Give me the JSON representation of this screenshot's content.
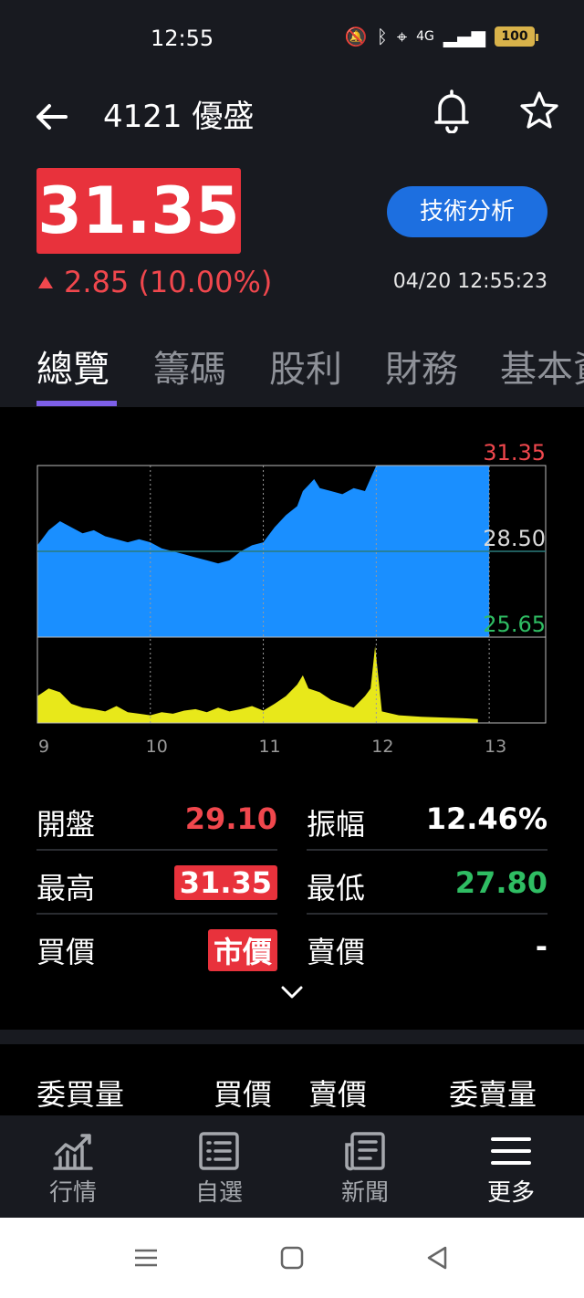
{
  "status_bar": {
    "time": "12:55",
    "network": "4G",
    "battery": "100"
  },
  "header": {
    "title": "4121 優盛",
    "price": "31.35",
    "change": "2.85 (10.00%)",
    "timestamp": "04/20 12:55:23",
    "tech_button": "技術分析"
  },
  "tabs": [
    {
      "label": "總覽",
      "active": true
    },
    {
      "label": "籌碼"
    },
    {
      "label": "股利"
    },
    {
      "label": "財務"
    },
    {
      "label": "基本資料"
    }
  ],
  "chart_data": {
    "type": "area",
    "x_ticks": [
      "9",
      "10",
      "11",
      "12",
      "13"
    ],
    "y_ticks": [
      {
        "label": "31.35",
        "color": "#f0474d"
      },
      {
        "label": "28.50",
        "color": "#d9d9d9"
      },
      {
        "label": "25.65",
        "color": "#2fbd63"
      }
    ],
    "reference_price": 28.5,
    "ylim": [
      25.65,
      31.35
    ],
    "xlim": [
      9,
      13.5
    ],
    "price_series": [
      [
        9.0,
        28.7
      ],
      [
        9.1,
        29.2
      ],
      [
        9.2,
        29.5
      ],
      [
        9.3,
        29.3
      ],
      [
        9.4,
        29.1
      ],
      [
        9.5,
        29.2
      ],
      [
        9.6,
        29.0
      ],
      [
        9.7,
        28.9
      ],
      [
        9.8,
        28.8
      ],
      [
        9.9,
        28.9
      ],
      [
        10.0,
        28.8
      ],
      [
        10.1,
        28.6
      ],
      [
        10.2,
        28.5
      ],
      [
        10.3,
        28.4
      ],
      [
        10.4,
        28.3
      ],
      [
        10.5,
        28.2
      ],
      [
        10.6,
        28.1
      ],
      [
        10.7,
        28.2
      ],
      [
        10.8,
        28.5
      ],
      [
        10.9,
        28.7
      ],
      [
        11.0,
        28.8
      ],
      [
        11.1,
        29.3
      ],
      [
        11.2,
        29.7
      ],
      [
        11.3,
        30.0
      ],
      [
        11.35,
        30.5
      ],
      [
        11.4,
        30.7
      ],
      [
        11.45,
        30.9
      ],
      [
        11.5,
        30.6
      ],
      [
        11.6,
        30.5
      ],
      [
        11.7,
        30.4
      ],
      [
        11.8,
        30.6
      ],
      [
        11.9,
        30.5
      ],
      [
        12.0,
        31.35
      ],
      [
        13.0,
        31.35
      ]
    ],
    "volume_series": [
      [
        9.0,
        0.35
      ],
      [
        9.1,
        0.45
      ],
      [
        9.2,
        0.4
      ],
      [
        9.3,
        0.25
      ],
      [
        9.4,
        0.2
      ],
      [
        9.5,
        0.18
      ],
      [
        9.6,
        0.15
      ],
      [
        9.7,
        0.22
      ],
      [
        9.8,
        0.14
      ],
      [
        9.9,
        0.12
      ],
      [
        10.0,
        0.1
      ],
      [
        10.1,
        0.14
      ],
      [
        10.2,
        0.12
      ],
      [
        10.3,
        0.16
      ],
      [
        10.4,
        0.18
      ],
      [
        10.5,
        0.14
      ],
      [
        10.6,
        0.2
      ],
      [
        10.7,
        0.15
      ],
      [
        10.8,
        0.18
      ],
      [
        10.9,
        0.22
      ],
      [
        11.0,
        0.16
      ],
      [
        11.1,
        0.25
      ],
      [
        11.2,
        0.35
      ],
      [
        11.3,
        0.5
      ],
      [
        11.35,
        0.62
      ],
      [
        11.4,
        0.45
      ],
      [
        11.5,
        0.4
      ],
      [
        11.6,
        0.3
      ],
      [
        11.7,
        0.25
      ],
      [
        11.8,
        0.2
      ],
      [
        11.9,
        0.35
      ],
      [
        11.95,
        0.45
      ],
      [
        11.99,
        1.0
      ],
      [
        12.05,
        0.15
      ],
      [
        12.2,
        0.1
      ],
      [
        12.4,
        0.08
      ],
      [
        12.6,
        0.07
      ],
      [
        12.8,
        0.06
      ],
      [
        12.9,
        0.05
      ]
    ],
    "volume_ylim": [
      0,
      1.0
    ]
  },
  "stats": {
    "open_label": "開盤",
    "open_value": "29.10",
    "amplitude_label": "振幅",
    "amplitude_value": "12.46%",
    "high_label": "最高",
    "high_value": "31.35",
    "low_label": "最低",
    "low_value": "27.80",
    "bid_label": "買價",
    "bid_value": "市價",
    "ask_label": "賣價",
    "ask_value": "-"
  },
  "order_book_header": {
    "bid_volume": "委買量",
    "bid_price": "買價",
    "ask_price": "賣價",
    "ask_volume": "委賣量"
  },
  "bottom_nav": [
    {
      "label": "行情",
      "icon": "chart-icon"
    },
    {
      "label": "自選",
      "icon": "list-icon"
    },
    {
      "label": "新聞",
      "icon": "news-icon"
    },
    {
      "label": "更多",
      "icon": "menu-icon",
      "active": true
    }
  ],
  "colors": {
    "up": "#f0474d",
    "down": "#2fbd63",
    "area": "#1a8fff",
    "volume": "#e8e81a",
    "accent": "#7d5fe8"
  }
}
